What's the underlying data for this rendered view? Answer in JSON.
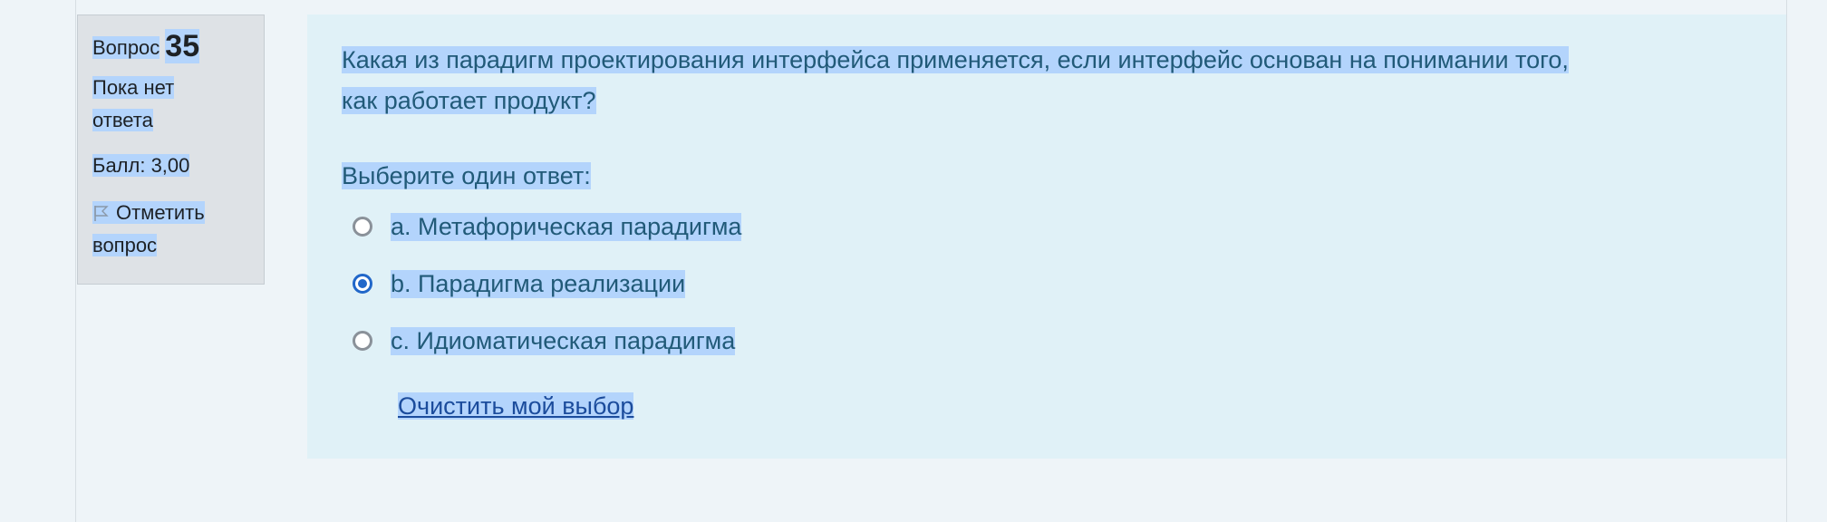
{
  "info": {
    "question_label": "Вопрос",
    "question_number": "35",
    "state_line1": "Пока нет",
    "state_line2": "ответа",
    "grade": "Балл: 3,00",
    "flag_line1": "Отметить",
    "flag_line2": "вопрос",
    "flag_icon": "flag-icon"
  },
  "question": {
    "text_line1": "Какая из парадигм проектирования интерфейса применяется, если интерфейс основан на понимании того,",
    "text_line2": "как работает продукт?",
    "prompt": "Выберите один ответ:",
    "options": [
      {
        "label": "a. Метафорическая парадигма",
        "selected": false
      },
      {
        "label": "b. Парадигма реализации",
        "selected": true
      },
      {
        "label": "c. Идиоматическая парадигма",
        "selected": false
      }
    ],
    "clear_label": "Очистить мой выбор"
  },
  "colors": {
    "selection_highlight": "#b3d4fc",
    "content_bg": "#e0f1f7",
    "text": "#215a78",
    "radio_selected": "#2167c9",
    "link": "#1b4c9c"
  }
}
